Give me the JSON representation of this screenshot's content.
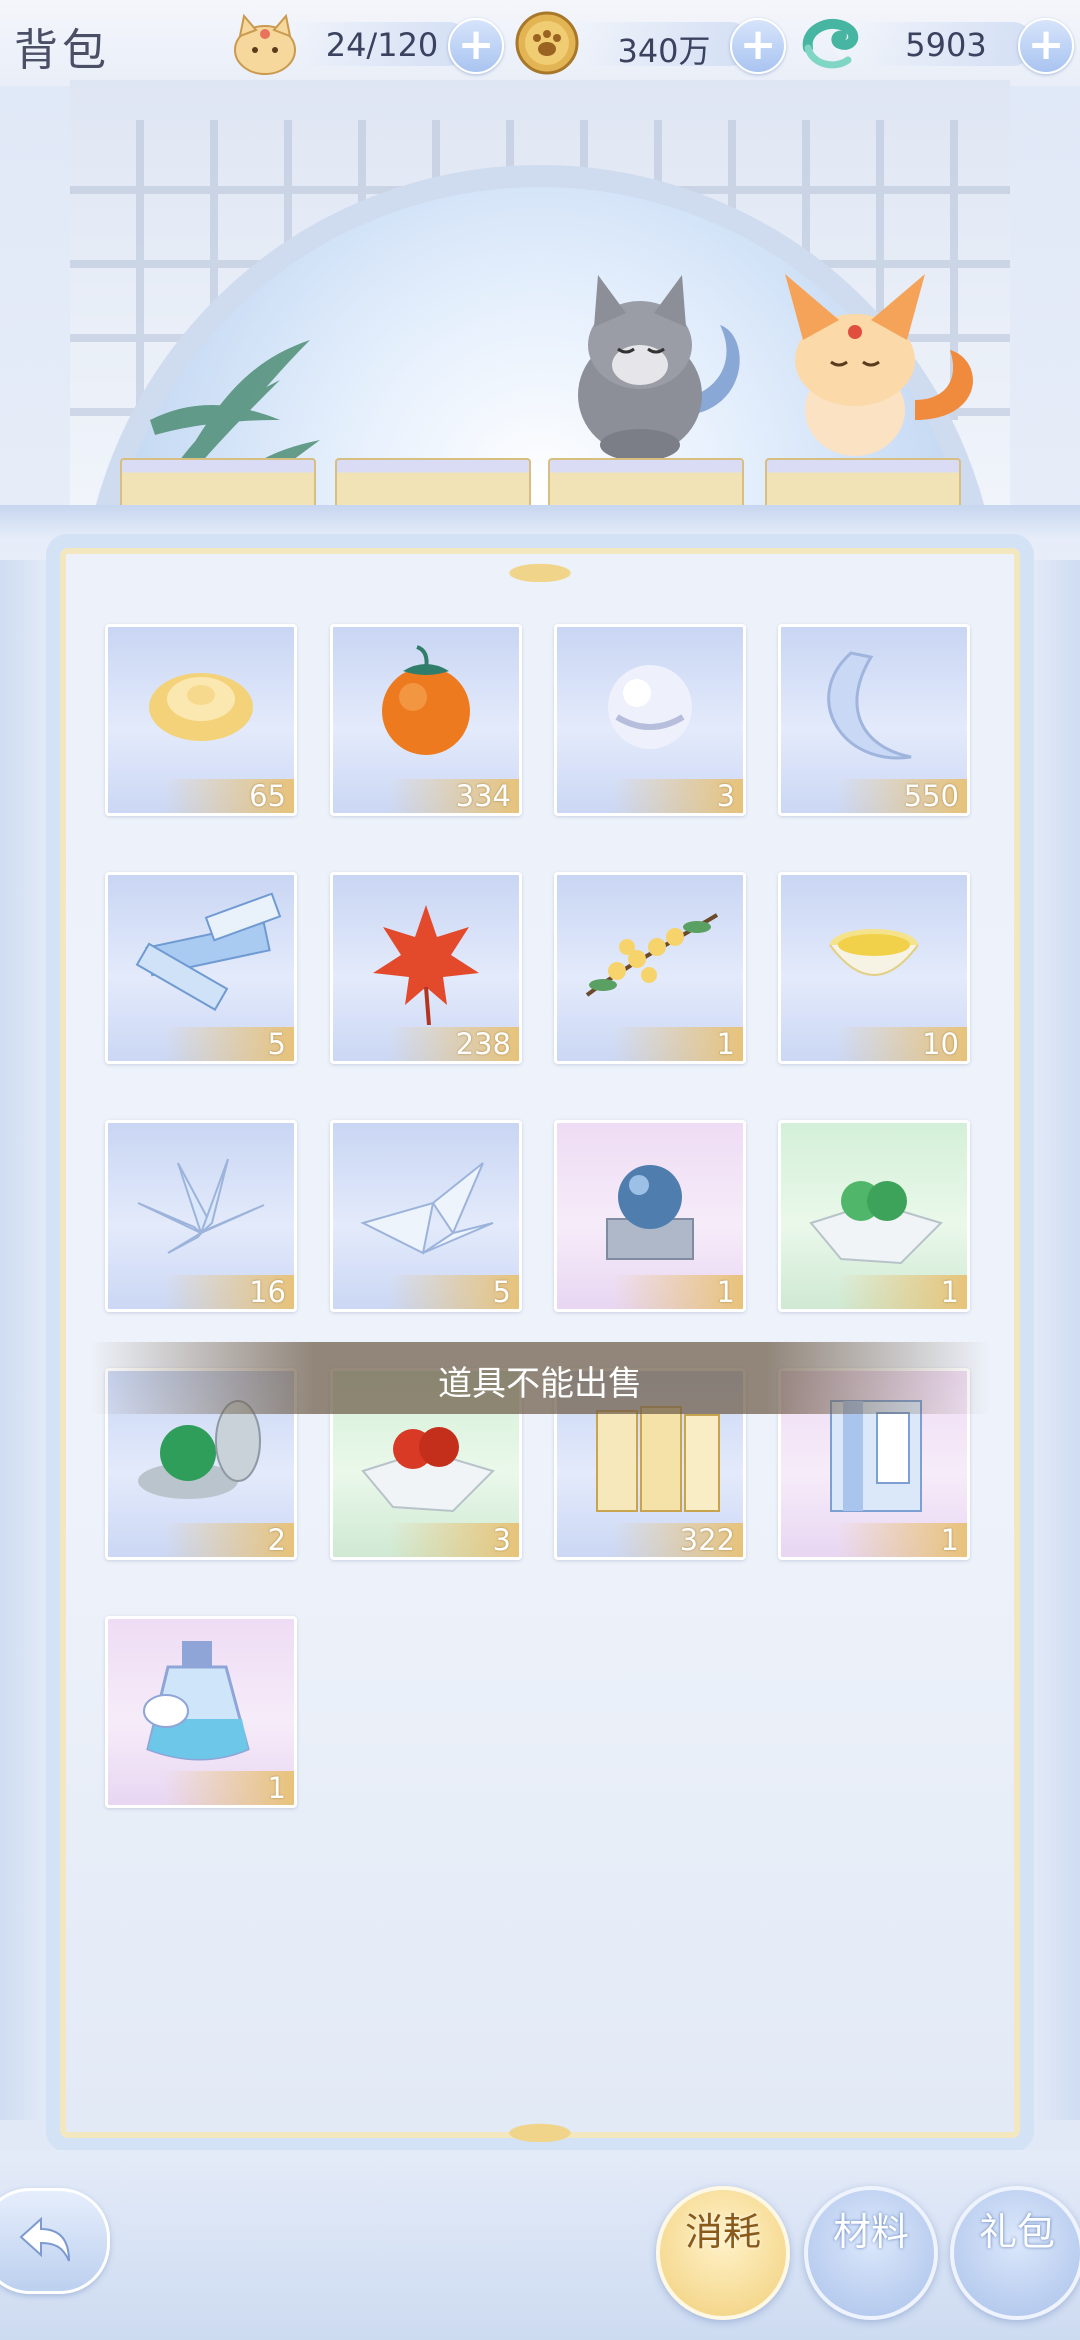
{
  "header": {
    "title": "背包",
    "resources": [
      {
        "icon": "cat-face-icon",
        "value": "24/120"
      },
      {
        "icon": "paw-coin-icon",
        "value": "340万"
      },
      {
        "icon": "jade-dragon-icon",
        "value": "5903"
      }
    ]
  },
  "scene": {
    "pets": [
      "grey-cat-pet",
      "orange-fox-pet"
    ]
  },
  "items": [
    {
      "name": "golden-flower",
      "count": "65",
      "bg": "blue"
    },
    {
      "name": "persimmon",
      "count": "334",
      "bg": "blue"
    },
    {
      "name": "pearl",
      "count": "3",
      "bg": "blue"
    },
    {
      "name": "crescent-crystal",
      "count": "550",
      "bg": "blue"
    },
    {
      "name": "scroll",
      "count": "5",
      "bg": "blue"
    },
    {
      "name": "maple-leaf",
      "count": "238",
      "bg": "blue"
    },
    {
      "name": "osmanthus-branch",
      "count": "1",
      "bg": "blue"
    },
    {
      "name": "tea-bowl",
      "count": "10",
      "bg": "blue"
    },
    {
      "name": "crystal-leaves",
      "count": "16",
      "bg": "blue"
    },
    {
      "name": "paper-crane",
      "count": "5",
      "bg": "blue"
    },
    {
      "name": "blue-orb-stand",
      "count": "1",
      "bg": "pink"
    },
    {
      "name": "green-pills",
      "count": "1",
      "bg": "green"
    },
    {
      "name": "green-orb-box",
      "count": "2",
      "bg": "blue"
    },
    {
      "name": "red-pills",
      "count": "3",
      "bg": "green"
    },
    {
      "name": "book-set",
      "count": "322",
      "bg": "blue"
    },
    {
      "name": "blue-book",
      "count": "1",
      "bg": "pink"
    },
    {
      "name": "double-potion",
      "count": "1",
      "bg": "pink"
    }
  ],
  "toast": "道具不能出售",
  "tabs": [
    {
      "label": "消耗",
      "active": true
    },
    {
      "label": "材料",
      "active": false
    },
    {
      "label": "礼包",
      "active": false
    }
  ]
}
